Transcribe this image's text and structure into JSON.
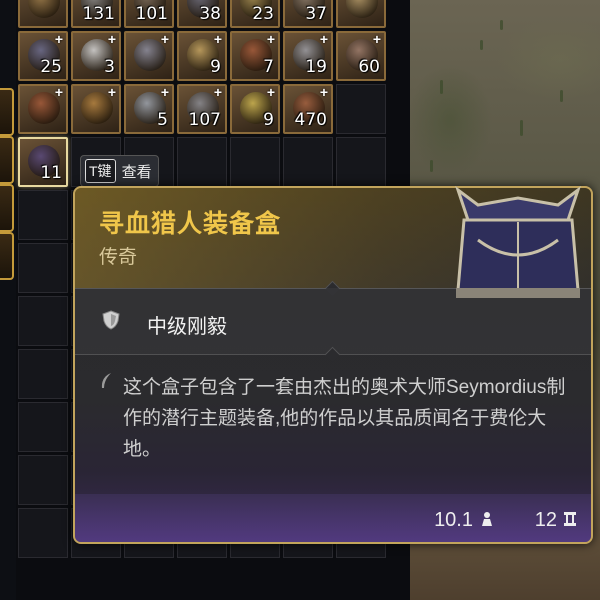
{
  "inventory": {
    "rows": [
      [
        {
          "qty": "",
          "plus": false,
          "blue": false,
          "color": "#9a7a4a",
          "icon": "pouch-icon"
        },
        {
          "qty": "131",
          "plus": true,
          "blue": false,
          "color": "#888888",
          "icon": "metal-icon"
        },
        {
          "qty": "101",
          "plus": true,
          "blue": false,
          "color": "#7a6a5a",
          "icon": "scroll-icon"
        },
        {
          "qty": "38",
          "plus": true,
          "blue": false,
          "color": "#6a6a7a",
          "icon": "armor-icon"
        },
        {
          "qty": "23",
          "plus": true,
          "blue": false,
          "color": "#a08a50",
          "icon": "cloth-icon"
        },
        {
          "qty": "37",
          "plus": true,
          "blue": false,
          "color": "#8a7a6a",
          "icon": "helmet-icon"
        },
        {
          "qty": "",
          "plus": false,
          "blue": false,
          "color": "#b49a6a",
          "icon": "bottle-icon"
        }
      ],
      [
        {
          "qty": "25",
          "plus": true,
          "blue": false,
          "color": "#6a6a8a",
          "icon": "bag-icon"
        },
        {
          "qty": "3",
          "plus": true,
          "blue": false,
          "color": "#d0d0d0",
          "icon": "shield-icon"
        },
        {
          "qty": "",
          "plus": true,
          "blue": false,
          "color": "#8a8a9a",
          "icon": "dagger-icon"
        },
        {
          "qty": "9",
          "plus": true,
          "blue": false,
          "color": "#c0a060",
          "icon": "box-icon"
        },
        {
          "qty": "7",
          "plus": true,
          "blue": false,
          "color": "#a05a3a",
          "icon": "potions-icon"
        },
        {
          "qty": "19",
          "plus": true,
          "blue": false,
          "color": "#9a9aa0",
          "icon": "gauntlet-icon"
        },
        {
          "qty": "60",
          "plus": true,
          "blue": false,
          "color": "#9a7a6a",
          "icon": "armor-icon"
        }
      ],
      [
        {
          "qty": "",
          "plus": true,
          "blue": false,
          "color": "#a05a3a",
          "icon": "food-icon"
        },
        {
          "qty": "",
          "plus": true,
          "blue": false,
          "color": "#b08040",
          "icon": "sack-icon"
        },
        {
          "qty": "5",
          "plus": true,
          "blue": false,
          "color": "#9aa0aa",
          "icon": "keys-icon"
        },
        {
          "qty": "107",
          "plus": true,
          "blue": false,
          "color": "#8a8a90",
          "icon": "ingot-icon"
        },
        {
          "qty": "9",
          "plus": true,
          "blue": false,
          "color": "#c8b050",
          "icon": "gold-icon"
        },
        {
          "qty": "470",
          "plus": true,
          "blue": false,
          "color": "#a06040",
          "icon": "coin-pouch-icon"
        }
      ],
      [
        {
          "qty": "11",
          "plus": false,
          "blue": false,
          "sel": true,
          "color": "#5a4a7a",
          "icon": "chest-icon"
        }
      ]
    ]
  },
  "hint": {
    "key": "T键",
    "label": "查看"
  },
  "tooltip": {
    "title": "寻血猎人装备盒",
    "rarity": "传奇",
    "stat": "中级刚毅",
    "description": "这个盒子包含了一套由杰出的奥术大师Seymordius制作的潜行主题装备,他的作品以其品质闻名于费伦大地。",
    "weight": "10.1",
    "level": "12"
  }
}
